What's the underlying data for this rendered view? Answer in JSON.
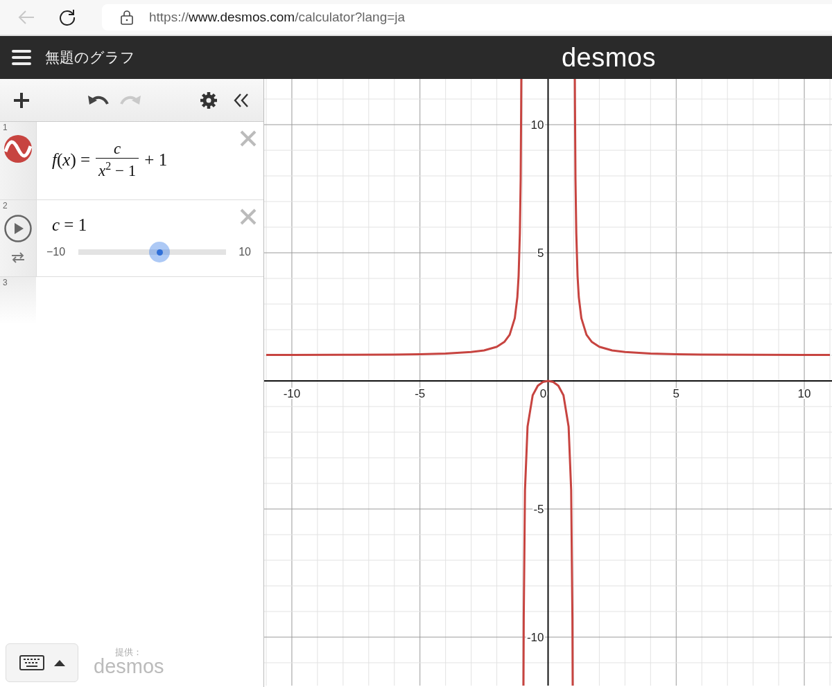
{
  "browser": {
    "back_disabled": true,
    "url_scheme": "https://",
    "url_host": "www.desmos.com",
    "url_path": "/calculator?lang=ja"
  },
  "header": {
    "title": "無題のグラフ",
    "logo": "desmos"
  },
  "toolbar": {
    "undo_disabled": false,
    "redo_disabled": true
  },
  "expressions": [
    {
      "kind": "function",
      "number": "1",
      "color": "#c74440",
      "lhs": "*f*(*x*) =",
      "numerator": "c",
      "denominator": "*x*$^{2}$ − 1",
      "tail": "+ 1"
    },
    {
      "kind": "slider",
      "number": "2",
      "playing": false,
      "lhs": "*c* = 1",
      "min": "−10",
      "max": "10",
      "level": 0.55
    },
    {
      "kind": "empty",
      "number": "3"
    }
  ],
  "footer": {
    "credit": "提供：",
    "credit_logo": "desmos"
  },
  "graph": {
    "chart_data": {
      "type": "line",
      "grid": true,
      "xlim": [
        -11.081,
        11.081
      ],
      "ylim": [
        -11.892,
        11.784
      ],
      "xticks": [
        -10,
        -5,
        0,
        5,
        10
      ],
      "yticks": [
        -10,
        -5,
        5,
        10
      ],
      "x": [
        -11,
        -10,
        -8,
        -6,
        -5,
        -4,
        -3,
        -2.5,
        -2,
        -1.7,
        -1.5,
        -1.3,
        -1.2,
        -1.15,
        -1.1,
        -1.07,
        -1.05,
        -1.0454,
        null,
        -0.9604,
        -0.95,
        -0.9,
        -0.8,
        -0.6,
        -0.4,
        -0.2,
        0,
        0.2,
        0.4,
        0.6,
        0.8,
        0.9,
        0.95,
        0.9604,
        null,
        1.0454,
        1.05,
        1.07,
        1.1,
        1.15,
        1.2,
        1.3,
        1.5,
        1.7,
        2,
        2.5,
        3,
        4,
        5,
        6,
        8,
        10,
        11
      ],
      "series": [
        {
          "color": "#c74440",
          "values": [
            1.01,
            1.01,
            1.02,
            1.03,
            1.04,
            1.07,
            1.13,
            1.19,
            1.33,
            1.53,
            1.8,
            2.45,
            3.27,
            4.1,
            5.76,
            7.9,
            10.76,
            11.78,
            null,
            -11.89,
            -9.26,
            -4.26,
            -1.78,
            -0.56,
            -0.19,
            -0.04,
            0,
            -0.04,
            -0.19,
            -0.56,
            -1.78,
            -4.26,
            -9.26,
            -11.89,
            null,
            11.78,
            10.76,
            7.9,
            5.76,
            4.1,
            3.27,
            2.45,
            1.8,
            1.53,
            1.33,
            1.19,
            1.13,
            1.07,
            1.04,
            1.03,
            1.02,
            1.01,
            1.01
          ]
        }
      ]
    }
  }
}
